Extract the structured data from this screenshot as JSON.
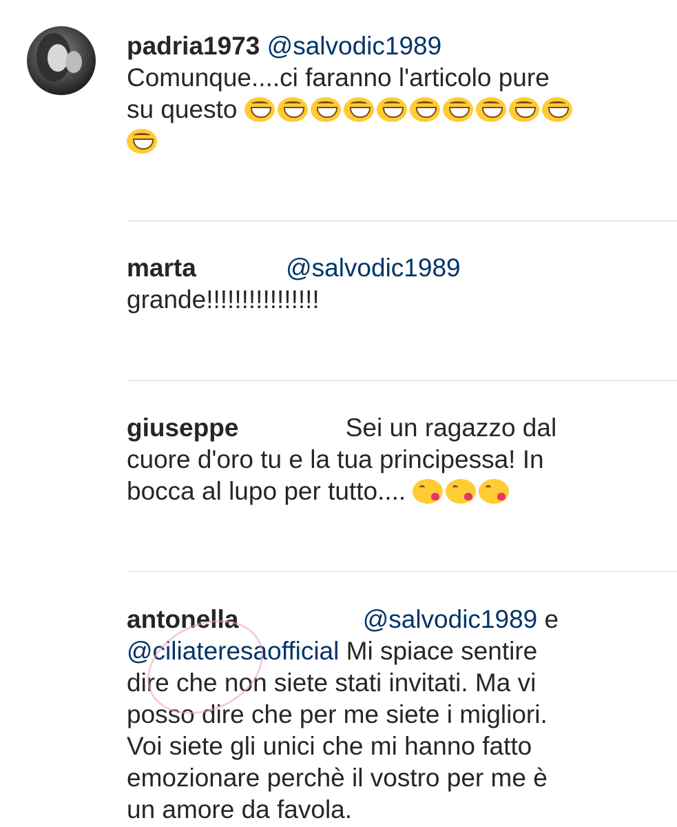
{
  "comments": [
    {
      "username": "padria1973",
      "mention": "@salvodic1989",
      "text": "Comunque....ci faranno l'articolo pure su questo",
      "emoji": [
        "grinning-squinting-face",
        "grinning-squinting-face",
        "grinning-squinting-face",
        "grinning-squinting-face",
        "grinning-squinting-face",
        "grinning-squinting-face",
        "grinning-squinting-face",
        "grinning-squinting-face",
        "grinning-squinting-face",
        "grinning-squinting-face",
        "grinning-squinting-face"
      ]
    },
    {
      "username": "marta",
      "mention": "@salvodic1989",
      "text": "grande!!!!!!!!!!!!!!!!"
    },
    {
      "username": "giuseppe",
      "text": "Sei un ragazzo dal cuore d'oro tu e la tua principessa! In bocca al lupo per tutto....",
      "emoji": [
        "face-blowing-kiss",
        "face-blowing-kiss",
        "face-blowing-kiss"
      ]
    },
    {
      "username": "antonella",
      "mention": "@salvodic1989",
      "joiner": "e",
      "mention2": "@ciliateresaofficial",
      "text": "Mi spiace sentire dire che non siete stati invitati.  Ma vi posso dire che per me siete i migliori. Voi siete gli unici che mi hanno fatto emozionare perchè il vostro per me è un amore da favola."
    }
  ],
  "colors": {
    "username": "#262626",
    "mention": "#003569",
    "text": "#262626",
    "divider": "#dbdbdb"
  }
}
